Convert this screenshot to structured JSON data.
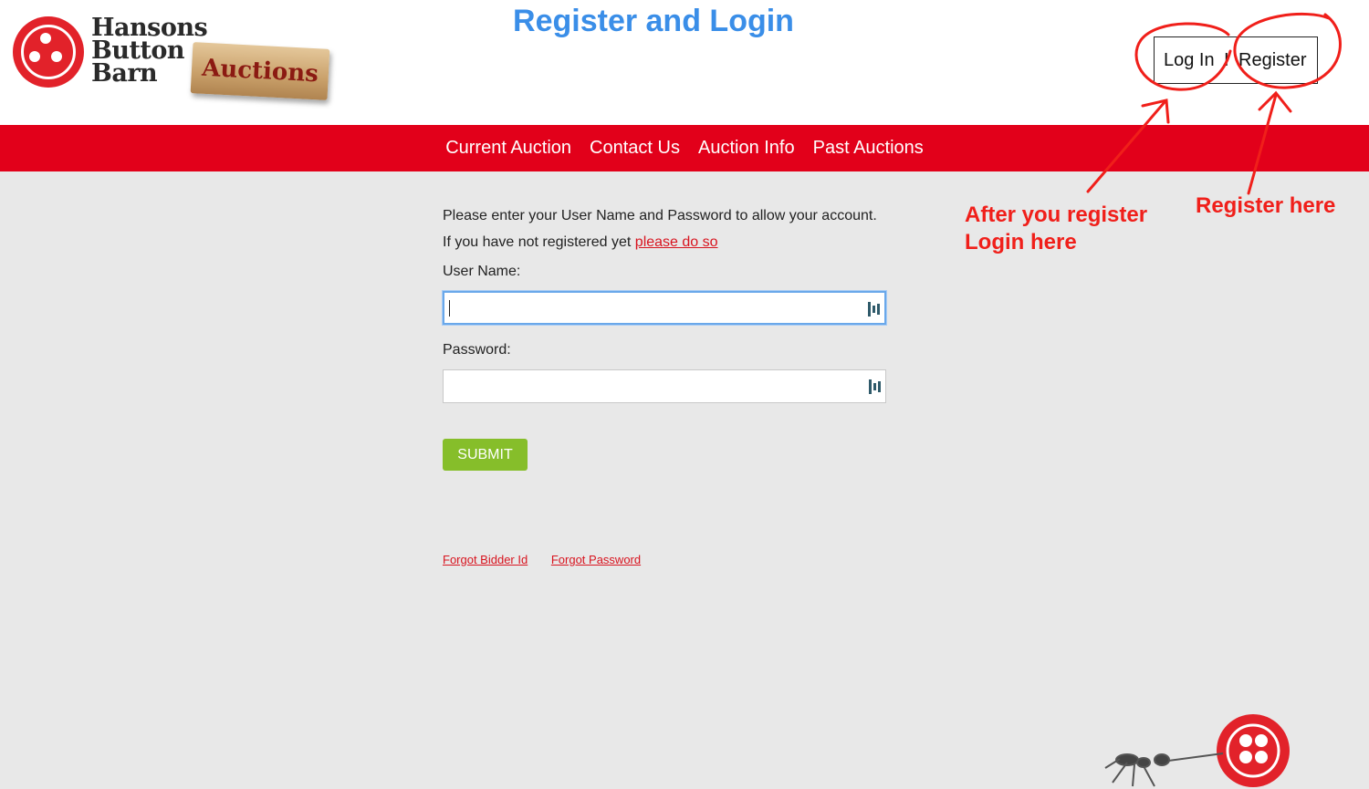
{
  "header": {
    "logo": {
      "line1": "Hansons",
      "line2": "Button",
      "line3": "Barn",
      "tag": "Auctions"
    },
    "page_title": "Register and Login",
    "auth": {
      "login_label": "Log In",
      "separator": "I",
      "register_label": "Register"
    }
  },
  "nav": {
    "items": [
      {
        "label": "Current Auction"
      },
      {
        "label": "Contact Us"
      },
      {
        "label": "Auction Info"
      },
      {
        "label": "Past Auctions"
      }
    ]
  },
  "form": {
    "intro_line1": "Please enter your User Name and Password to allow your account.",
    "intro_line2_prefix": "If you have not registered yet",
    "register_link": "please do so",
    "username_label": "User Name:",
    "username_value": "",
    "password_label": "Password:",
    "password_value": "",
    "submit_label": "SUBMIT"
  },
  "footer_links": {
    "forgot_bidder_id": "Forgot Bidder Id",
    "forgot_password": "Forgot Password"
  },
  "annotations": {
    "login_note_line1": "After you register",
    "login_note_line2": "Login here",
    "register_note": "Register here",
    "color": "#f01f1a"
  },
  "colors": {
    "brand_red": "#e2001a",
    "title_blue": "#3a8ee8",
    "submit_green": "#86be2a",
    "link_red": "#d8141f"
  }
}
